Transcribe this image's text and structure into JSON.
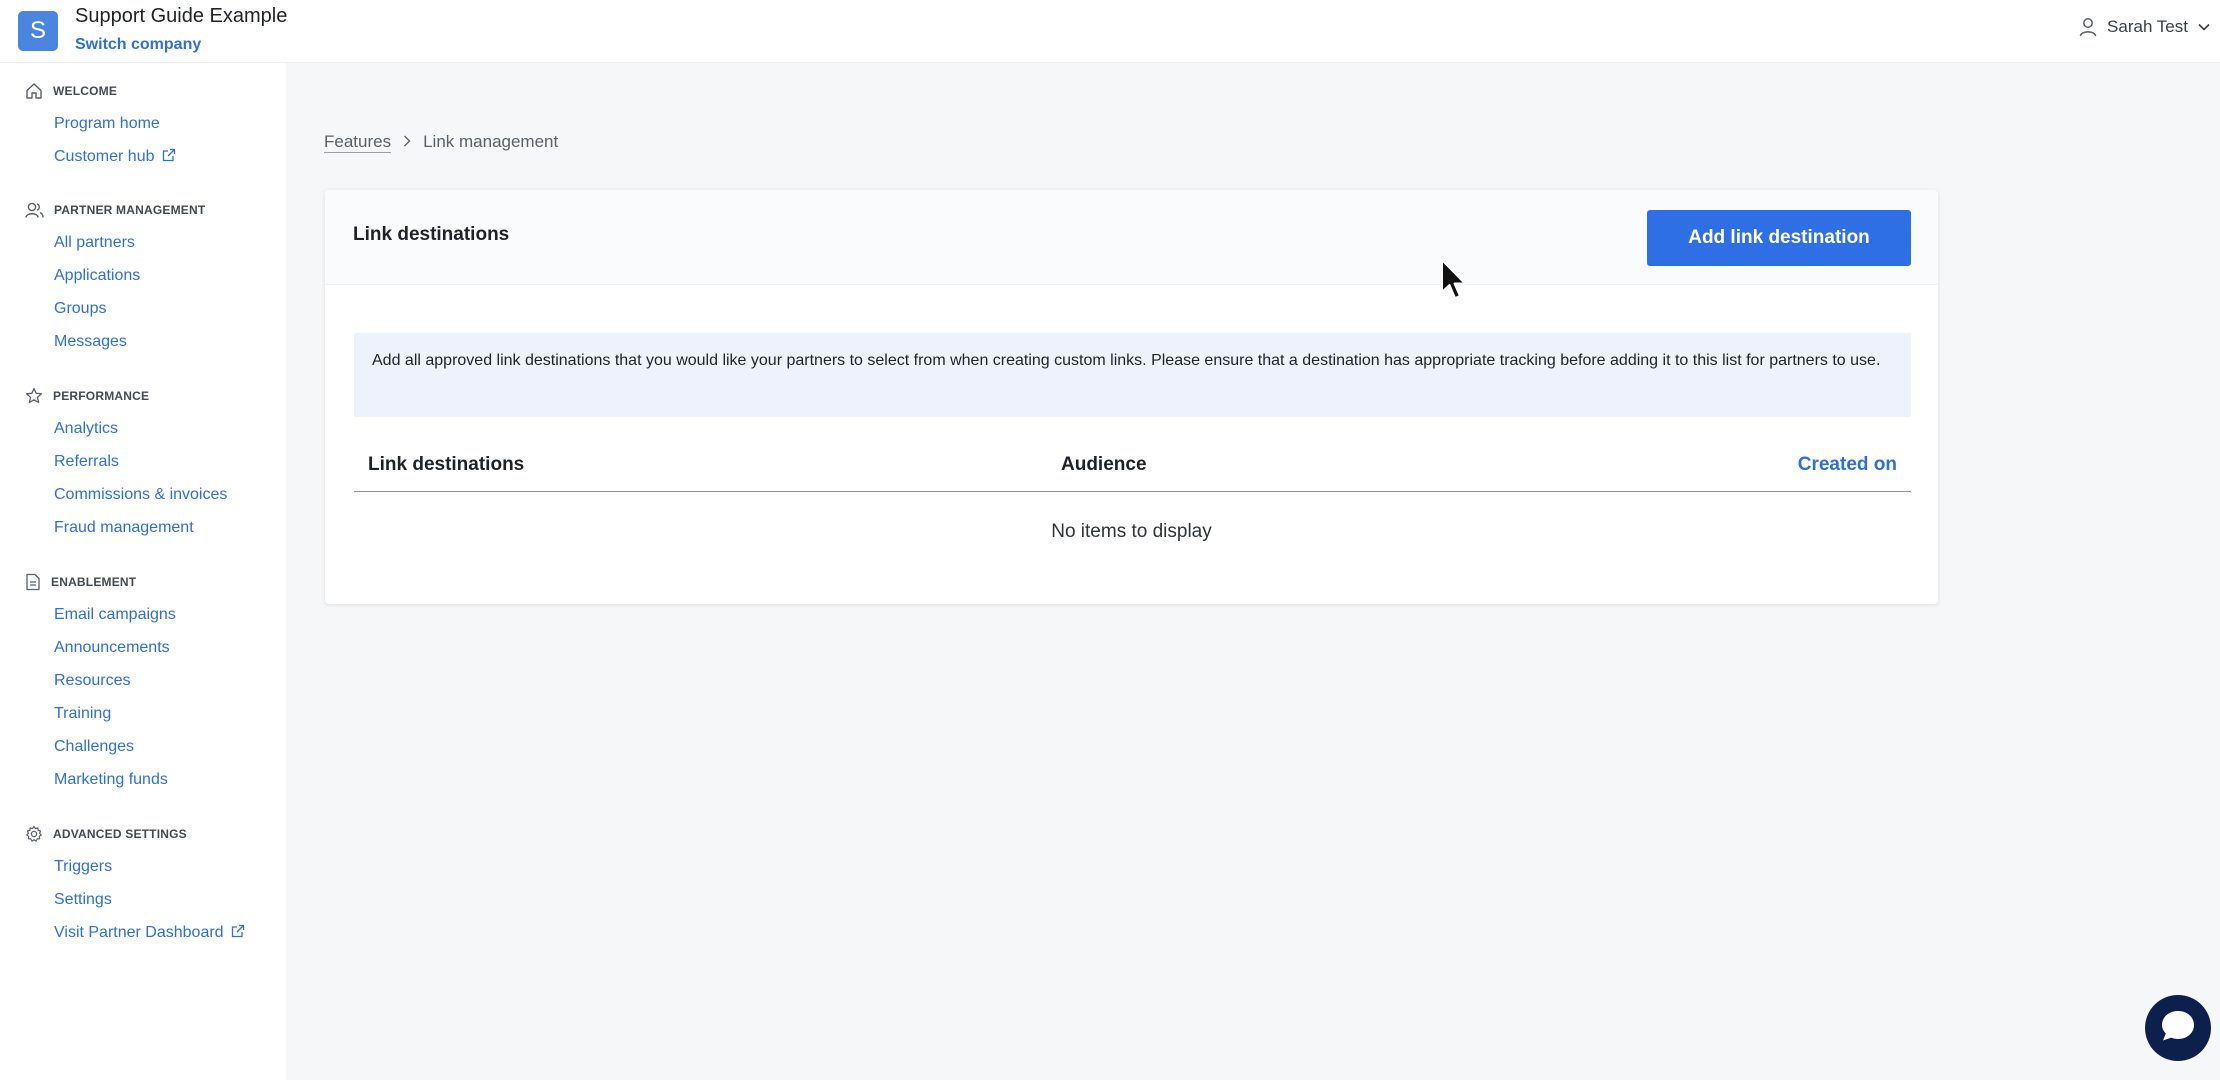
{
  "header": {
    "logo_letter": "S",
    "company_name": "Support Guide Example",
    "switch_company": "Switch company",
    "user_name": "Sarah Test"
  },
  "sidebar": {
    "sections": [
      {
        "title": "WELCOME",
        "icon": "home-icon",
        "items": [
          "Program home",
          "Customer hub"
        ]
      },
      {
        "title": "PARTNER MANAGEMENT",
        "icon": "users-icon",
        "items": [
          "All partners",
          "Applications",
          "Groups",
          "Messages"
        ]
      },
      {
        "title": "PERFORMANCE",
        "icon": "star-icon",
        "items": [
          "Analytics",
          "Referrals",
          "Commissions & invoices",
          "Fraud management"
        ]
      },
      {
        "title": "ENABLEMENT",
        "icon": "document-icon",
        "items": [
          "Email campaigns",
          "Announcements",
          "Resources",
          "Training",
          "Challenges",
          "Marketing funds"
        ]
      },
      {
        "title": "ADVANCED SETTINGS",
        "icon": "gear-icon",
        "items": [
          "Triggers",
          "Settings",
          "Visit Partner Dashboard"
        ]
      }
    ]
  },
  "breadcrumb": {
    "parent": "Features",
    "current": "Link management"
  },
  "card": {
    "title": "Link destinations",
    "add_button": "Add link destination",
    "info_text": "Add all approved link destinations that you would like your partners to select from when creating custom links. Please ensure that a destination has appropriate tracking before adding it to this list for partners to use.",
    "columns": [
      "Link destinations",
      "Audience",
      "Created on"
    ],
    "empty_text": "No items to display"
  },
  "colors": {
    "accent": "#2f6fe6",
    "link": "#2f6fd6",
    "logo": "#4a86e0",
    "info_bg": "#edf2fd",
    "chat": "#0d1f4d"
  }
}
